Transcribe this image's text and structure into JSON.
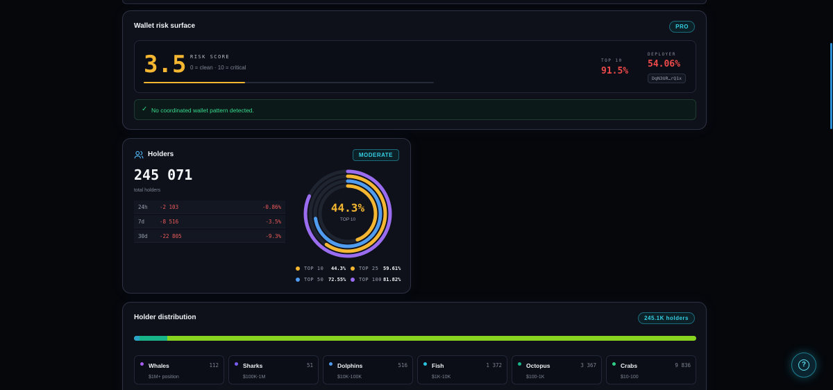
{
  "risk": {
    "title": "Wallet risk surface",
    "badge": "PRO",
    "score": "3.5",
    "score_label": "RISK SCORE",
    "score_scale": "0 = clean · 10 = critical",
    "score_fraction": 0.35,
    "top10_label": "TOP 10",
    "top10_value": "91.5%",
    "deployer_label": "DEPLOYER",
    "deployer_value": "54.06%",
    "deployer_address": "DqN3UR…rQ1x",
    "alert_icon": "check-icon",
    "alert_text": "No coordinated wallet pattern detected."
  },
  "holders": {
    "title": "Holders",
    "icon": "users-icon",
    "badge": "MODERATE",
    "total": "245 071",
    "total_caption": "total holders",
    "changes": [
      {
        "period": "24h",
        "abs": "-2 103",
        "pct": "-0.86%"
      },
      {
        "period": "7d",
        "abs": "-8 516",
        "pct": "-3.5%"
      },
      {
        "period": "30d",
        "abs": "-22 805",
        "pct": "-9.3%"
      }
    ],
    "donut_value": "44.3%",
    "donut_label": "TOP 10",
    "concentration": [
      {
        "label": "TOP 10",
        "value": "44.3%",
        "fraction": 0.443,
        "color": "#f5b731"
      },
      {
        "label": "TOP 25",
        "value": "59.61%",
        "fraction": 0.5961,
        "color": "#f5b731"
      },
      {
        "label": "TOP 50",
        "value": "72.55%",
        "fraction": 0.7255,
        "color": "#4f9cf0"
      },
      {
        "label": "TOP 100",
        "value": "81.82%",
        "fraction": 0.8182,
        "color": "#9a6cf0"
      }
    ]
  },
  "distribution": {
    "title": "Holder distribution",
    "badge": "245.1K holders",
    "bar_colors": {
      "first": "#2aa4c6",
      "second": "#19b38a",
      "rest": "#86d41f"
    },
    "tiers": [
      {
        "name": "Whales",
        "count": "112",
        "range": "$1M+ position",
        "color": "#a45cf0"
      },
      {
        "name": "Sharks",
        "count": "51",
        "range": "$100K-1M",
        "color": "#7a5cf0"
      },
      {
        "name": "Dolphins",
        "count": "516",
        "range": "$10K-100K",
        "color": "#4f9cf0"
      },
      {
        "name": "Fish",
        "count": "1 372",
        "range": "$1K-10K",
        "color": "#2ac4e0"
      },
      {
        "name": "Octopus",
        "count": "3 367",
        "range": "$100-1K",
        "color": "#19b38a"
      },
      {
        "name": "Crabs",
        "count": "9 836",
        "range": "$10-100",
        "color": "#2fce86"
      }
    ]
  },
  "help": {
    "icon": "help-icon",
    "glyph": "?"
  }
}
